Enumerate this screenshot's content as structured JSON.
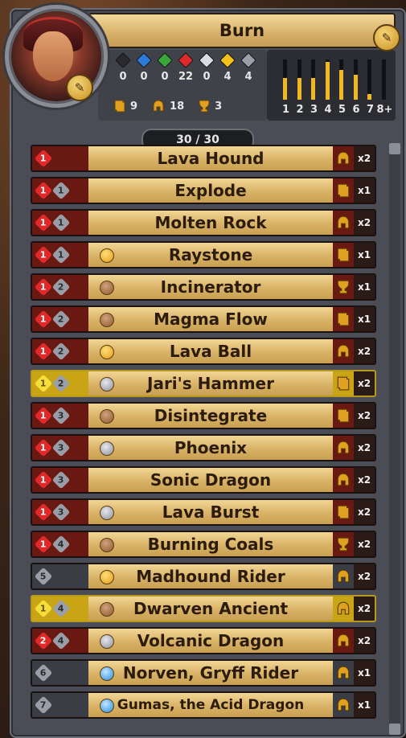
{
  "deck": {
    "title": "Burn",
    "count": "30 / 30"
  },
  "gems": [
    {
      "name": "shadow-gem-icon",
      "color": "#2a2a2e",
      "count": "0"
    },
    {
      "name": "sapphire-gem-icon",
      "color": "#2d7bd8",
      "count": "0"
    },
    {
      "name": "wild-gem-icon",
      "color": "#3aa63a",
      "count": "0"
    },
    {
      "name": "ruby-gem-icon",
      "color": "#e02a2a",
      "count": "22"
    },
    {
      "name": "diamond-gem-icon",
      "color": "#d8dde4",
      "count": "0"
    },
    {
      "name": "gold-gem-icon",
      "color": "#f2c21a",
      "count": "4"
    },
    {
      "name": "neutral-gem-icon",
      "color": "#9a9ea6",
      "count": "4"
    }
  ],
  "types": [
    {
      "name": "spell-icon",
      "count": "9"
    },
    {
      "name": "creature-icon",
      "count": "18"
    },
    {
      "name": "relic-icon",
      "count": "3"
    }
  ],
  "curve": {
    "labels": [
      "1",
      "2",
      "3",
      "4",
      "5",
      "6",
      "7",
      "8+"
    ],
    "fill": [
      0.55,
      0.55,
      0.55,
      0.95,
      0.75,
      0.62,
      0.15,
      0.0
    ],
    "accent": "#f2b824"
  },
  "cards": [
    {
      "cost": "1",
      "threshold": "",
      "color": "red",
      "rarity": "",
      "name": "Lava Hound",
      "type": "creature",
      "qty": "x2"
    },
    {
      "cost": "1",
      "threshold": "1",
      "color": "red",
      "rarity": "",
      "name": "Explode",
      "type": "spell",
      "qty": "x1"
    },
    {
      "cost": "1",
      "threshold": "1",
      "color": "red",
      "rarity": "",
      "name": "Molten Rock",
      "type": "creature",
      "qty": "x2"
    },
    {
      "cost": "1",
      "threshold": "1",
      "color": "red",
      "rarity": "rare",
      "name": "Raystone",
      "type": "spell",
      "qty": "x1"
    },
    {
      "cost": "1",
      "threshold": "2",
      "color": "red",
      "rarity": "uncommon",
      "name": "Incinerator",
      "type": "relic",
      "qty": "x1"
    },
    {
      "cost": "1",
      "threshold": "2",
      "color": "red",
      "rarity": "uncommon",
      "name": "Magma Flow",
      "type": "spell",
      "qty": "x1"
    },
    {
      "cost": "1",
      "threshold": "2",
      "color": "red",
      "rarity": "rare",
      "name": "Lava Ball",
      "type": "creature",
      "qty": "x2"
    },
    {
      "cost": "1",
      "threshold": "2",
      "color": "gold",
      "rarity": "silver",
      "name": "Jari's Hammer",
      "type": "spell",
      "qty": "x2"
    },
    {
      "cost": "1",
      "threshold": "3",
      "color": "red",
      "rarity": "uncommon",
      "name": "Disintegrate",
      "type": "spell",
      "qty": "x2"
    },
    {
      "cost": "1",
      "threshold": "3",
      "color": "red",
      "rarity": "silver",
      "name": "Phoenix",
      "type": "creature",
      "qty": "x2"
    },
    {
      "cost": "1",
      "threshold": "3",
      "color": "red",
      "rarity": "",
      "name": "Sonic Dragon",
      "type": "creature",
      "qty": "x2"
    },
    {
      "cost": "1",
      "threshold": "3",
      "color": "red",
      "rarity": "silver",
      "name": "Lava Burst",
      "type": "spell",
      "qty": "x2"
    },
    {
      "cost": "1",
      "threshold": "4",
      "color": "red",
      "rarity": "uncommon",
      "name": "Burning Coals",
      "type": "relic",
      "qty": "x2"
    },
    {
      "cost": "5",
      "threshold": "",
      "color": "gray",
      "rarity": "rare",
      "name": "Madhound Rider",
      "type": "creature",
      "qty": "x2"
    },
    {
      "cost": "1",
      "threshold": "4",
      "color": "gold",
      "rarity": "uncommon",
      "name": "Dwarven Ancient",
      "type": "creature",
      "qty": "x2"
    },
    {
      "cost": "2",
      "threshold": "4",
      "color": "red",
      "rarity": "silver",
      "name": "Volcanic Dragon",
      "type": "creature",
      "qty": "x2"
    },
    {
      "cost": "6",
      "threshold": "",
      "color": "gray",
      "rarity": "epic",
      "name": "Norven, Gryff Rider",
      "type": "creature",
      "qty": "x1"
    },
    {
      "cost": "7",
      "threshold": "",
      "color": "gray",
      "rarity": "epic",
      "name": "Gumas, the Acid Dragon",
      "type": "creature",
      "qty": "x1"
    }
  ]
}
